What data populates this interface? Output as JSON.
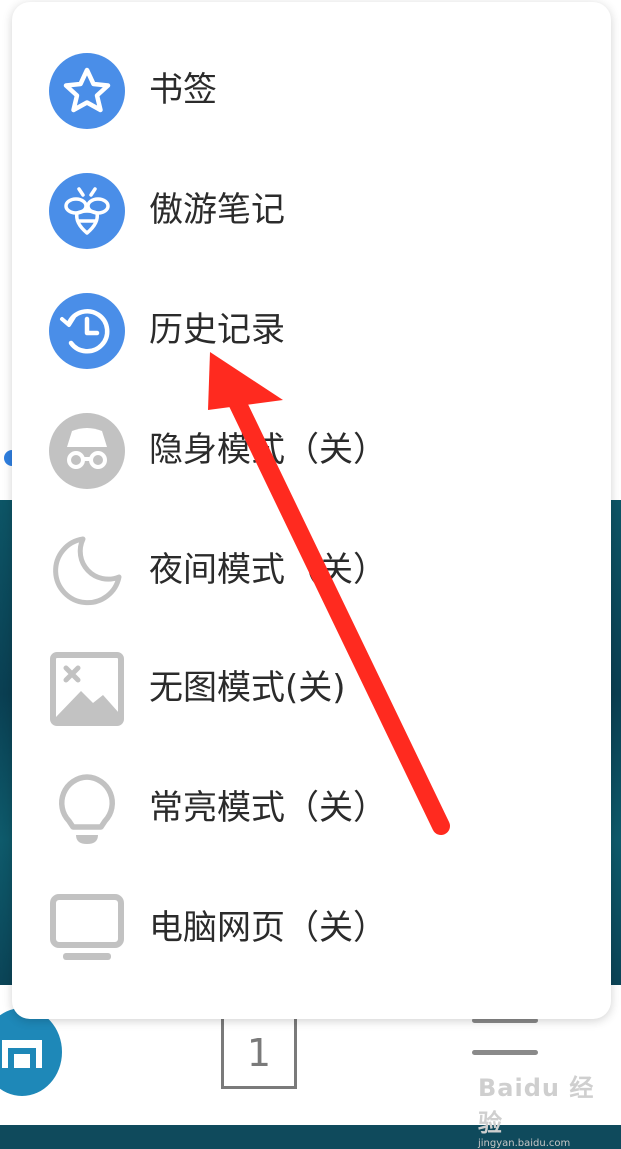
{
  "menu": {
    "items": [
      {
        "label": "书签",
        "icon": "star-icon",
        "active": true
      },
      {
        "label": "傲游笔记",
        "icon": "bee-icon",
        "active": true
      },
      {
        "label": "历史记录",
        "icon": "history-clock-icon",
        "active": true
      },
      {
        "label": "隐身模式（关）",
        "icon": "incognito-icon",
        "active": false
      },
      {
        "label": "夜间模式（关）",
        "icon": "moon-icon",
        "active": false
      },
      {
        "label": "无图模式(关)",
        "icon": "no-image-icon",
        "active": false
      },
      {
        "label": "常亮模式（关）",
        "icon": "lightbulb-icon",
        "active": false
      },
      {
        "label": "电脑网页（关）",
        "icon": "monitor-icon",
        "active": false
      }
    ]
  },
  "toolbar": {
    "tab_count": "1"
  },
  "watermark": {
    "main": "Baidu 经验",
    "sub": "jingyan.baidu.com"
  },
  "colors": {
    "active_icon": "#4a8ee8",
    "inactive_icon": "#c2c2c2",
    "annotation_arrow": "#ff2a1f"
  }
}
